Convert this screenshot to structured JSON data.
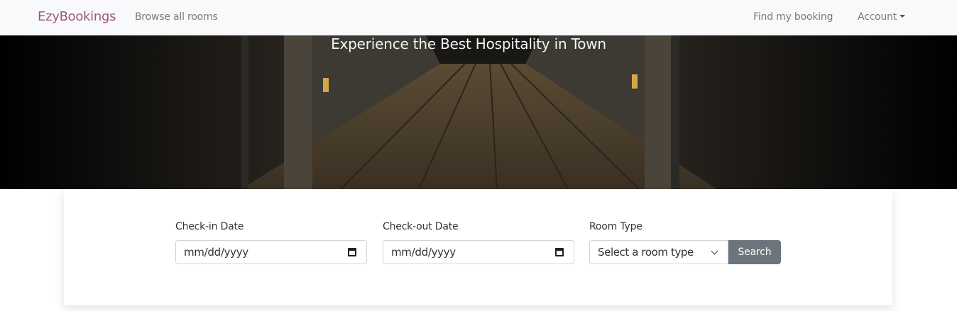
{
  "navbar": {
    "brand": "EzyBookings",
    "browse_label": "Browse all rooms",
    "find_label": "Find my booking",
    "account_label": "Account"
  },
  "hero": {
    "title": "Experience the Best Hospitality in Town"
  },
  "search": {
    "checkin_label": "Check-in Date",
    "checkin_placeholder": "mm/dd/yyyy",
    "checkout_label": "Check-out Date",
    "checkout_placeholder": "mm/dd/yyyy",
    "roomtype_label": "Room Type",
    "roomtype_value": "Select a room type",
    "search_label": "Search"
  },
  "icons": {
    "calendar": "calendar-icon",
    "chevron": "chevron-down-icon",
    "caret": "caret-down-icon"
  },
  "colors": {
    "brand": "#a0577f",
    "navbar_bg": "#f8f9fa",
    "button_bg": "#6c757d"
  }
}
